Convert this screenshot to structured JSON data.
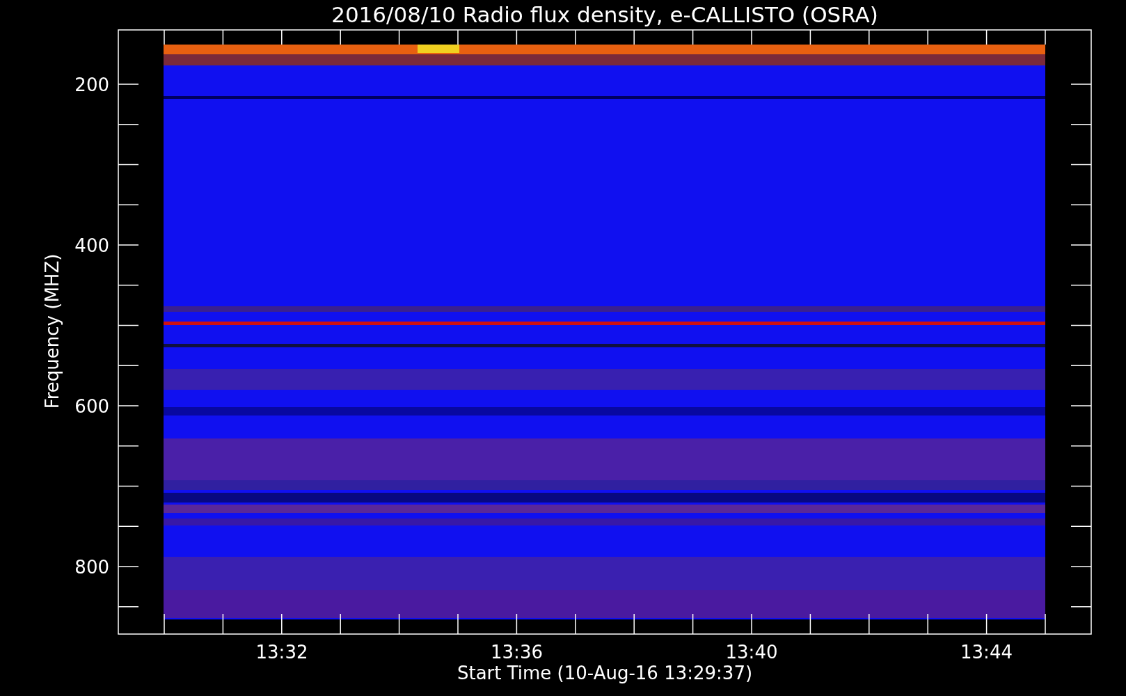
{
  "plot": {
    "title": "2016/08/10  Radio flux density, e-CALLISTO (OSRA)",
    "ylabel": "Frequency (MHZ)",
    "xlabel": "Start Time (10-Aug-16 13:29:37)",
    "yticks": [
      "200",
      "400",
      "600",
      "800"
    ],
    "xticks": [
      "13:32",
      "13:36",
      "13:40",
      "13:44"
    ]
  }
}
